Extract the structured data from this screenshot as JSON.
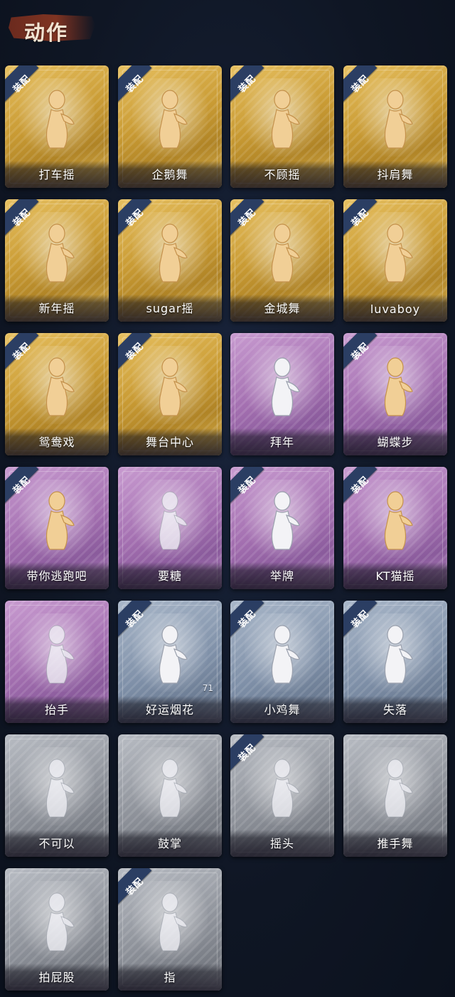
{
  "header": {
    "title": "动作"
  },
  "equip_badge": "装配",
  "colors": {
    "gold": "#d8ad45",
    "purple": "#a36fb0",
    "blue": "#7f90a8",
    "gray": "#8d9199",
    "badge": "#2b3e63"
  },
  "cards": [
    {
      "label": "打车摇",
      "rarity": "gold",
      "equipped": true,
      "figure": "gold",
      "icon": "dance-figure-icon"
    },
    {
      "label": "企鹅舞",
      "rarity": "gold",
      "equipped": true,
      "figure": "gold",
      "icon": "dance-figure-icon"
    },
    {
      "label": "不顾摇",
      "rarity": "gold",
      "equipped": true,
      "figure": "gold",
      "icon": "dance-figure-icon"
    },
    {
      "label": "抖肩舞",
      "rarity": "gold",
      "equipped": true,
      "figure": "gold",
      "icon": "dance-figure-icon"
    },
    {
      "label": "新年摇",
      "rarity": "gold",
      "equipped": true,
      "figure": "gold",
      "icon": "dance-figure-icon"
    },
    {
      "label": "sugar摇",
      "rarity": "gold",
      "equipped": true,
      "figure": "gold",
      "icon": "dance-figure-icon"
    },
    {
      "label": "金城舞",
      "rarity": "gold",
      "equipped": true,
      "figure": "gold",
      "icon": "dance-figure-icon"
    },
    {
      "label": "luvaboy",
      "rarity": "gold",
      "equipped": true,
      "figure": "gold",
      "icon": "dance-figure-icon"
    },
    {
      "label": "鸳鸯戏",
      "rarity": "gold",
      "equipped": true,
      "figure": "gold",
      "icon": "dance-figure-icon"
    },
    {
      "label": "舞台中心",
      "rarity": "gold",
      "equipped": true,
      "figure": "gold",
      "icon": "dance-figure-icon"
    },
    {
      "label": "拜年",
      "rarity": "purple",
      "equipped": false,
      "figure": "white",
      "icon": "bow-figure-icon"
    },
    {
      "label": "蝴蝶步",
      "rarity": "purple",
      "equipped": true,
      "figure": "gold",
      "icon": "dance-figure-icon"
    },
    {
      "label": "带你逃跑吧",
      "rarity": "purple",
      "equipped": true,
      "figure": "gold",
      "icon": "dance-figure-icon"
    },
    {
      "label": "要糖",
      "rarity": "purple",
      "equipped": false,
      "figure": "faded",
      "icon": "ask-candy-figure-icon"
    },
    {
      "label": "举牌",
      "rarity": "purple",
      "equipped": true,
      "figure": "white",
      "icon": "hold-sign-figure-icon"
    },
    {
      "label": "KT猫摇",
      "rarity": "purple",
      "equipped": true,
      "figure": "gold",
      "icon": "dance-figure-icon"
    },
    {
      "label": "抬手",
      "rarity": "purple",
      "equipped": false,
      "figure": "faded",
      "icon": "raise-hand-figure-icon"
    },
    {
      "label": "好运烟花",
      "rarity": "blue",
      "equipped": true,
      "figure": "white",
      "icon": "firework-icon",
      "count": "71"
    },
    {
      "label": "小鸡舞",
      "rarity": "blue",
      "equipped": true,
      "figure": "white",
      "icon": "chicken-dance-figure-icon"
    },
    {
      "label": "失落",
      "rarity": "blue",
      "equipped": true,
      "figure": "white",
      "icon": "crawl-figure-icon"
    },
    {
      "label": "不可以",
      "rarity": "gray",
      "equipped": false,
      "figure": "faded",
      "icon": "finger-wag-icon"
    },
    {
      "label": "鼓掌",
      "rarity": "gray",
      "equipped": false,
      "figure": "faded",
      "icon": "clap-hands-icon"
    },
    {
      "label": "摇头",
      "rarity": "gray",
      "equipped": true,
      "figure": "faded",
      "icon": "shake-head-figure-icon"
    },
    {
      "label": "推手舞",
      "rarity": "gray",
      "equipped": false,
      "figure": "faded",
      "icon": "push-hand-figure-icon"
    },
    {
      "label": "拍屁股",
      "rarity": "gray",
      "equipped": false,
      "figure": "faded",
      "icon": "slap-figure-icon"
    },
    {
      "label": "指",
      "rarity": "gray",
      "equipped": true,
      "figure": "faded",
      "icon": "point-hand-icon"
    }
  ]
}
